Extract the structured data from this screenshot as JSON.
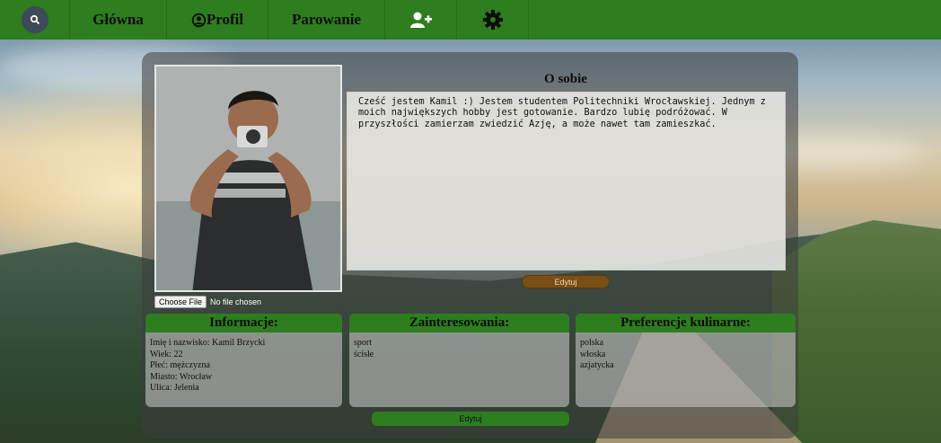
{
  "navbar": {
    "search_icon": "search-icon",
    "home_label": "Główna",
    "profile_label": "Profil",
    "profile_icon": "user-circle-icon",
    "pairing_label": "Parowanie",
    "add_user_icon": "add-user-icon",
    "settings_icon": "gear-icon",
    "color": "#2e7d1f"
  },
  "about": {
    "title": "O sobie",
    "text": "Cześć jestem Kamil :) Jestem studentem Politechniki Wrocławskiej. Jednym z moich największych hobby jest gotowanie. Bardzo lubię podróżować. W przyszłości zamierzam zwiedzić Azję, a może nawet tam zamieszkać.",
    "edit_label": "Edytuj"
  },
  "file_input": {
    "button_label": "Choose File",
    "status": "No file chosen"
  },
  "info": {
    "title": "Informacje:",
    "lines": [
      "Imię i nazwisko: Kamil Brzycki",
      "Wiek: 22",
      "Płeć: mężczyzna",
      "Miasto: Wrocław",
      "Ulica: Jelenia"
    ]
  },
  "interests": {
    "title": "Zainteresowania:",
    "items": [
      "sport",
      "ścisłe"
    ]
  },
  "food": {
    "title": "Preferencje kulinarne:",
    "items": [
      "polska",
      "włoska",
      "azjatycka"
    ]
  },
  "bottom_edit_label": "Edytuj"
}
